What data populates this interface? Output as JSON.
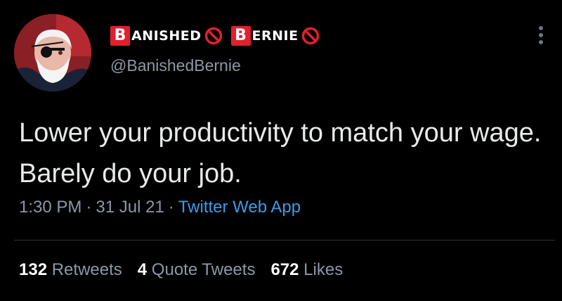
{
  "colors": {
    "background": "#000000",
    "badge_red": "#e0202c",
    "link_blue": "#3a9be9",
    "muted_text": "#8b98a5"
  },
  "author": {
    "avatar_icon": "avatar-photo",
    "display_name": {
      "part1_letter": "B",
      "part1_word": "ANISHED",
      "part2_letter": "B",
      "part2_word": "ERNIE",
      "emoji_icon": "prohibited-icon"
    },
    "handle": "@BanishedBernie"
  },
  "menu": {
    "icon": "more-vertical-icon"
  },
  "tweet": {
    "text": "Lower your productivity to match your wage. Barely do your job.",
    "time": "1:30 PM",
    "date": "31 Jul 21",
    "separator": "·",
    "source": "Twitter Web App"
  },
  "stats": [
    {
      "count": "132",
      "label": "Retweets"
    },
    {
      "count": "4",
      "label": "Quote Tweets"
    },
    {
      "count": "672",
      "label": "Likes"
    }
  ]
}
